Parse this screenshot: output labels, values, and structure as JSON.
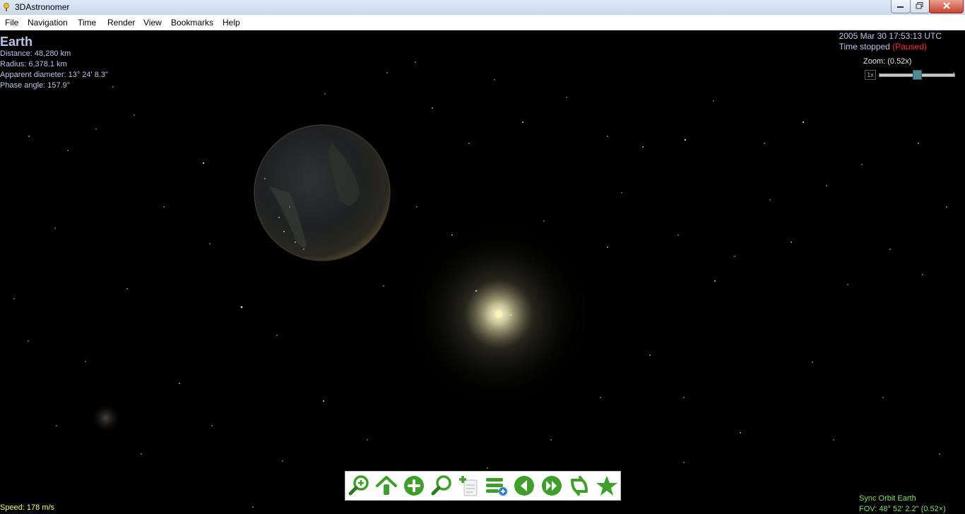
{
  "window": {
    "title": "3DAstronomer"
  },
  "menu": [
    "File",
    "Navigation",
    "Time",
    "Render",
    "View",
    "Bookmarks",
    "Help"
  ],
  "selected_object": {
    "name": "Earth",
    "distance": "Distance: 48,280 km",
    "radius": "Radius: 6,378.1 km",
    "apparent_diameter": "Apparent diameter: 13° 24' 8.3\"",
    "phase_angle": "Phase angle: 157.9°"
  },
  "time": {
    "datetime": "2005 Mar 30 17:53:13 UTC",
    "status_prefix": "Time stopped ",
    "status_paused": "(Paused)"
  },
  "zoom": {
    "label": "Zoom: (0.52x)",
    "box_label": "1x",
    "value": 0.52
  },
  "status": {
    "speed": "Speed: 178 m/s",
    "mode": "Sync Orbit Earth",
    "fov": "FOV: 48° 52' 2.2\" (0.52×)"
  },
  "toolbar": {
    "buttons": [
      {
        "name": "zoom-in-tool-icon"
      },
      {
        "name": "go-up-icon"
      },
      {
        "name": "add-icon"
      },
      {
        "name": "search-icon"
      },
      {
        "name": "add-document-icon"
      },
      {
        "name": "add-list-icon"
      },
      {
        "name": "rewind-icon"
      },
      {
        "name": "fast-forward-icon"
      },
      {
        "name": "refresh-sync-icon"
      },
      {
        "name": "favorite-star-icon"
      }
    ]
  },
  "colors": {
    "info_text": "#b9c6ea",
    "paused": "#ff2a2a",
    "speed_text": "#f2ff62",
    "status_text": "#7fe35d",
    "toolbar_green": "#3f9f2a"
  }
}
